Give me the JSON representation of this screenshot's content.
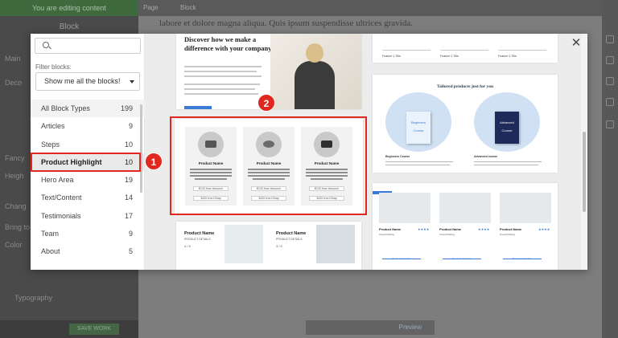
{
  "editor": {
    "editing_banner": "You are editing content",
    "block_panel_title": "Block",
    "side_labels": [
      "Main",
      "Deco",
      "Fancy",
      "Heigh",
      "Chang",
      "Bring to",
      "Color",
      "Typography"
    ],
    "crumbs": [
      "Page",
      "Block"
    ],
    "paragraph": "labore et dolore magna aliqua. Quis ipsum suspendisse ultrices gravida.",
    "save_label": "SAVE WORK",
    "preview_label": "Preview"
  },
  "modal": {
    "close_glyph": "✕",
    "search_placeholder": "",
    "filter_label": "Filter blocks:",
    "filter_value": "Show me all the blocks!",
    "categories": [
      {
        "label": "All Block Types",
        "count": "199"
      },
      {
        "label": "Articles",
        "count": "9"
      },
      {
        "label": "Steps",
        "count": "10"
      },
      {
        "label": "Product Highlight",
        "count": "10"
      },
      {
        "label": "Hero Area",
        "count": "19"
      },
      {
        "label": "Text/Content",
        "count": "14"
      },
      {
        "label": "Testimonials",
        "count": "17"
      },
      {
        "label": "Team",
        "count": "9"
      },
      {
        "label": "About",
        "count": "5"
      }
    ],
    "selected_category": "Product Highlight",
    "callouts": [
      "1",
      "2"
    ]
  },
  "previews": {
    "card1": {
      "title": "Discover how we make a difference with your company"
    },
    "product_highlight": {
      "product_name": "Product Name",
      "desc": "Lorem ipsum dolor sit amet, consectetur adipiscing elit, sed do eiusmod tempor",
      "btn_amazon": "$120 from Amazon",
      "btn_ebay": "$100 from Ebay"
    },
    "card4": {
      "product_name": "Product Name",
      "product_details": "PRODUCT DETAILS",
      "rating_left": "4 / 5",
      "rating_right": "3 / 5"
    },
    "features": [
      "Feature 1 Title",
      "Feature 2 Title",
      "Feature 3 Title"
    ],
    "tailored": {
      "title": "Tailored products just for you",
      "beginners": "Beginners",
      "advanced": "Advanced",
      "course": "Course",
      "beginners_course": "Beginners Course",
      "advanced_course": "Advanced course"
    },
    "products3": {
      "product_name": "Product Name",
      "overall_rating": "Overall Rating",
      "stars": "★★★★",
      "see_on_amazon": "See it on Amazon"
    }
  },
  "colors": {
    "accent_red": "#e0281f",
    "link_blue": "#3a7bd5"
  }
}
